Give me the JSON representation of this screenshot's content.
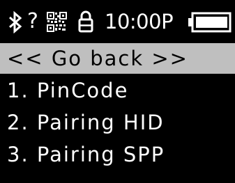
{
  "status_bar": {
    "bluetooth_icon": "bluetooth-icon",
    "unknown_indicator": "?",
    "qr_icon": "qr-code-icon",
    "lock_icon": "lock-icon",
    "time": "10:00P",
    "battery_icon": "battery-icon",
    "battery_level": 1.0
  },
  "menu": {
    "items": [
      {
        "label": "<< Go back >>",
        "selected": true
      },
      {
        "label": "1. PinCode",
        "selected": false
      },
      {
        "label": "2. Pairing HID",
        "selected": false
      },
      {
        "label": "3. Pairing SPP",
        "selected": false
      }
    ]
  },
  "colors": {
    "background": "#000000",
    "foreground": "#ffffff",
    "selection": "#bfbfbf"
  }
}
